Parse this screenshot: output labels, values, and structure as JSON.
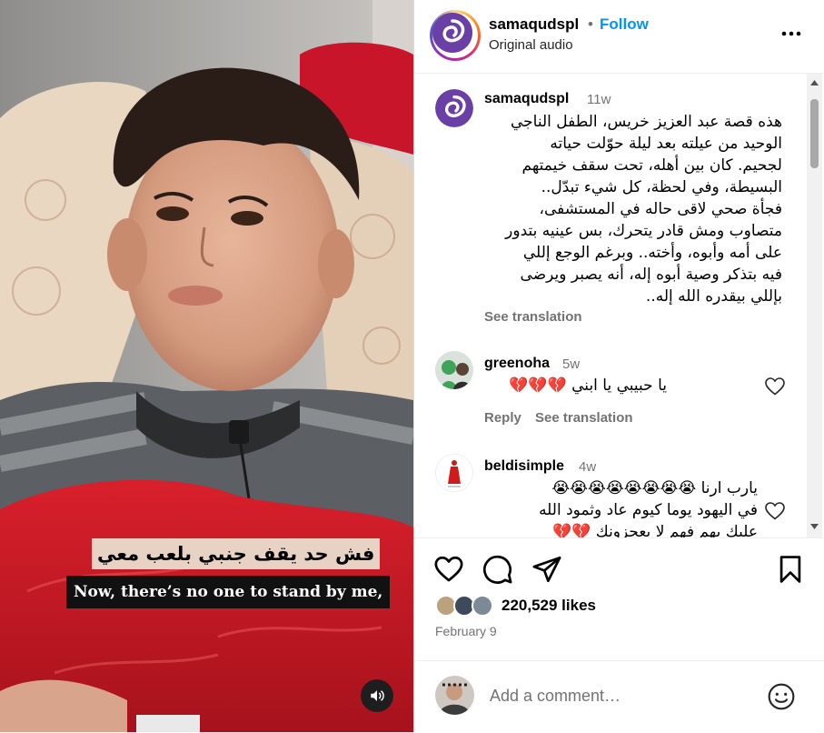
{
  "video": {
    "subtitle_arabic": "فش حد يقف جنبي بلعب معي",
    "subtitle_english": "Now, there’s no one to stand by me,",
    "mute_icon": "speaker-icon"
  },
  "header": {
    "username": "samaqudspl",
    "separator": "•",
    "follow_label": "Follow",
    "audio": "Original audio",
    "more_icon": "more-horizontal-icon"
  },
  "caption": {
    "username": "samaqudspl",
    "time": "11w",
    "lines": [
      "هذه قصة عبد العزيز خريس، الطفل الناجي",
      "الوحيد من عيلته بعد ليلة حوّلت حياته",
      "لجحيم. كان بين أهله، تحت سقف خيمتهم",
      "البسيطة، وفي لحظة، كل شيء تبدّل..",
      "فجأة صحي لاقى حاله في المستشفى،",
      "متصاوب ومش قادر يتحرك، بس عينيه بتدور",
      "على أمه وأبوه، وأخته.. وبرغم الوجع إللي",
      "فيه بتذكر وصية أبوه إله، أنه يصبر ويرضى",
      "بإللي بيقدره الله إله.."
    ],
    "see_translation": "See translation"
  },
  "comments": [
    {
      "username": "greenoha",
      "time": "5w",
      "lines": [
        "يا حبيبي يا ابني 💔💔💔"
      ],
      "reply": "Reply",
      "see_translation": "See translation"
    },
    {
      "username": "beldisimple",
      "time": "4w",
      "lines": [
        "يارب ارنا 😭😭😭😭😭😭😭😭",
        "في اليهود يوما كيوم عاد وثمود الله",
        "عليك بهم فهم لا يعجزونك 💔💔"
      ]
    }
  ],
  "actions": {
    "like_icon": "heart-icon",
    "comment_icon": "comment-icon",
    "share_icon": "share-icon",
    "save_icon": "bookmark-icon",
    "likes": "220,529 likes",
    "date": "February 9"
  },
  "add_comment": {
    "placeholder": "Add a comment…",
    "emoji_icon": "smiley-icon"
  },
  "colors": {
    "accent_blue": "#0095f6",
    "heart_red": "#e0245e",
    "logo_purple": "#6a3fa6"
  }
}
